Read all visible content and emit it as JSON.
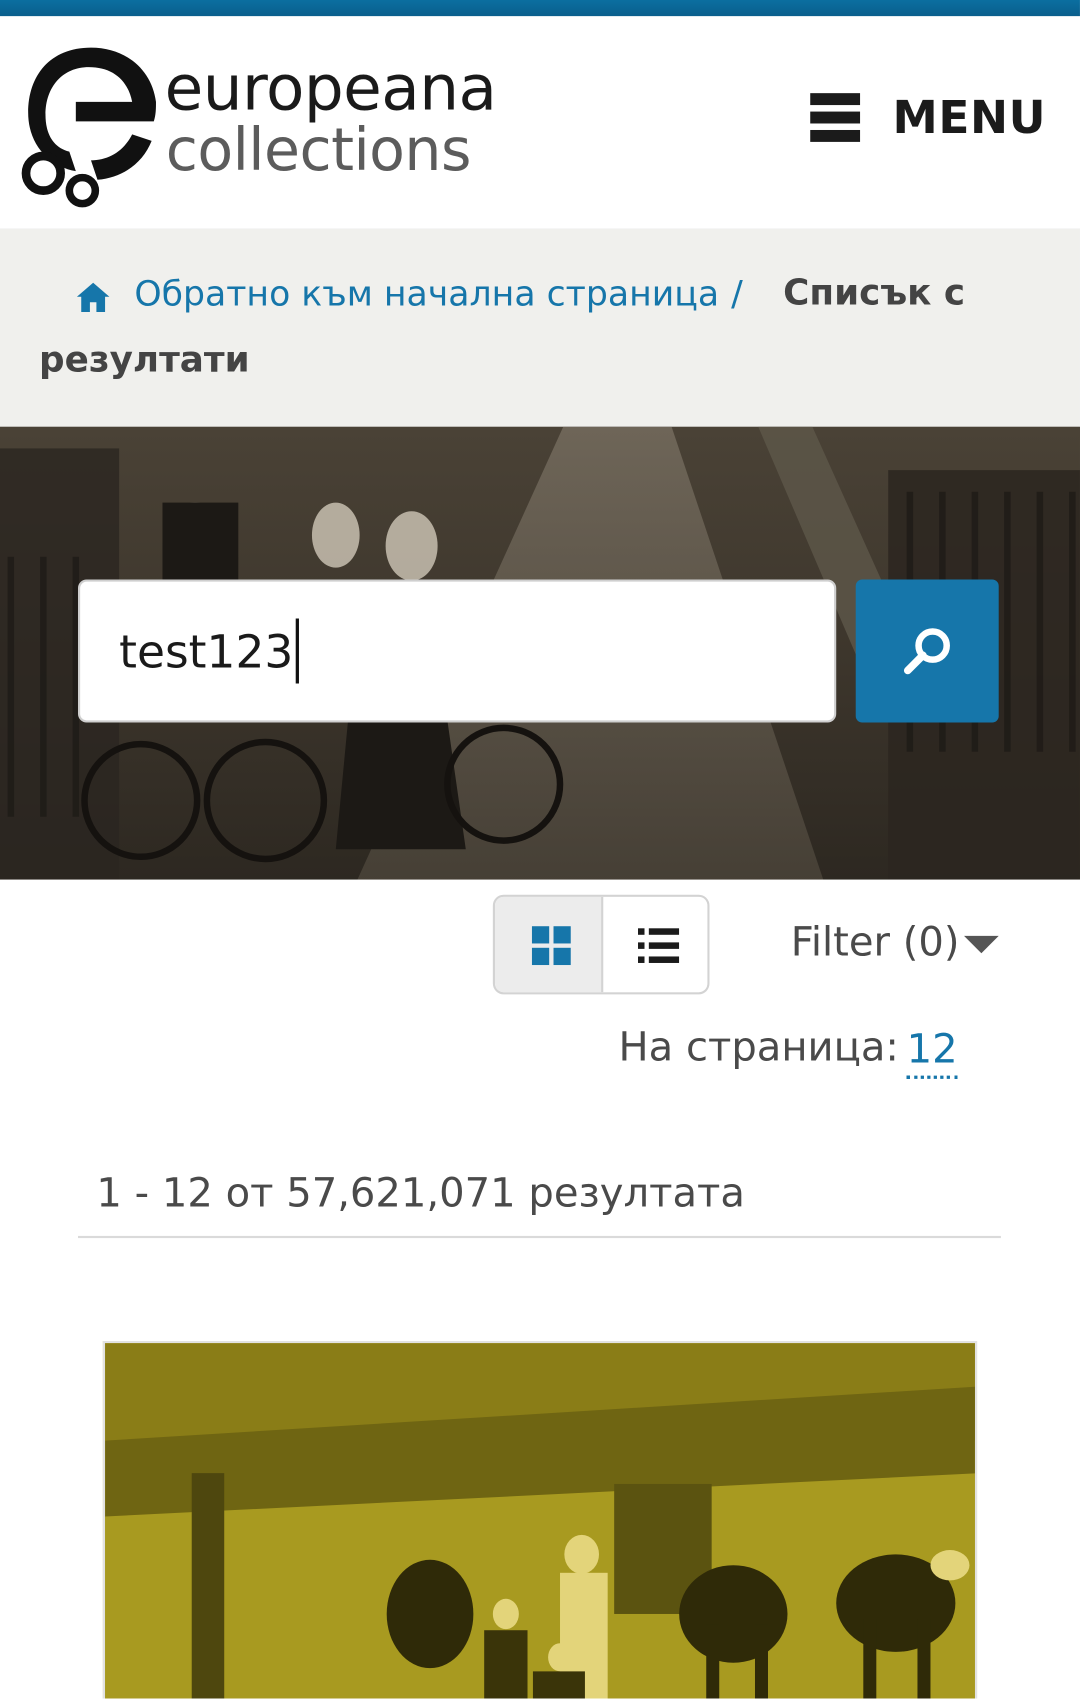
{
  "header": {
    "logo_line1": "europeana",
    "logo_line2": "collections",
    "menu_label": "MENU",
    "menu_icon": "hamburger-icon"
  },
  "breadcrumb": {
    "home_icon": "home-icon",
    "home_label": "Обратно към начална страница",
    "separator": "/",
    "current_line1": "Списък с",
    "current_line2": "резултати"
  },
  "search": {
    "query": "test123",
    "button_icon": "search-icon"
  },
  "toolbar": {
    "grid_view_icon": "grid-view-icon",
    "list_view_icon": "list-view-icon",
    "filter_label": "Filter (0)",
    "per_page_label": "На страница:",
    "per_page_value": "12"
  },
  "results": {
    "summary": "1 - 12 от 57,621,071 резултата"
  },
  "colors": {
    "accent": "#1676aa",
    "breadcrumb_bg": "#f0f0ed",
    "card_tint": "#a89a20"
  }
}
